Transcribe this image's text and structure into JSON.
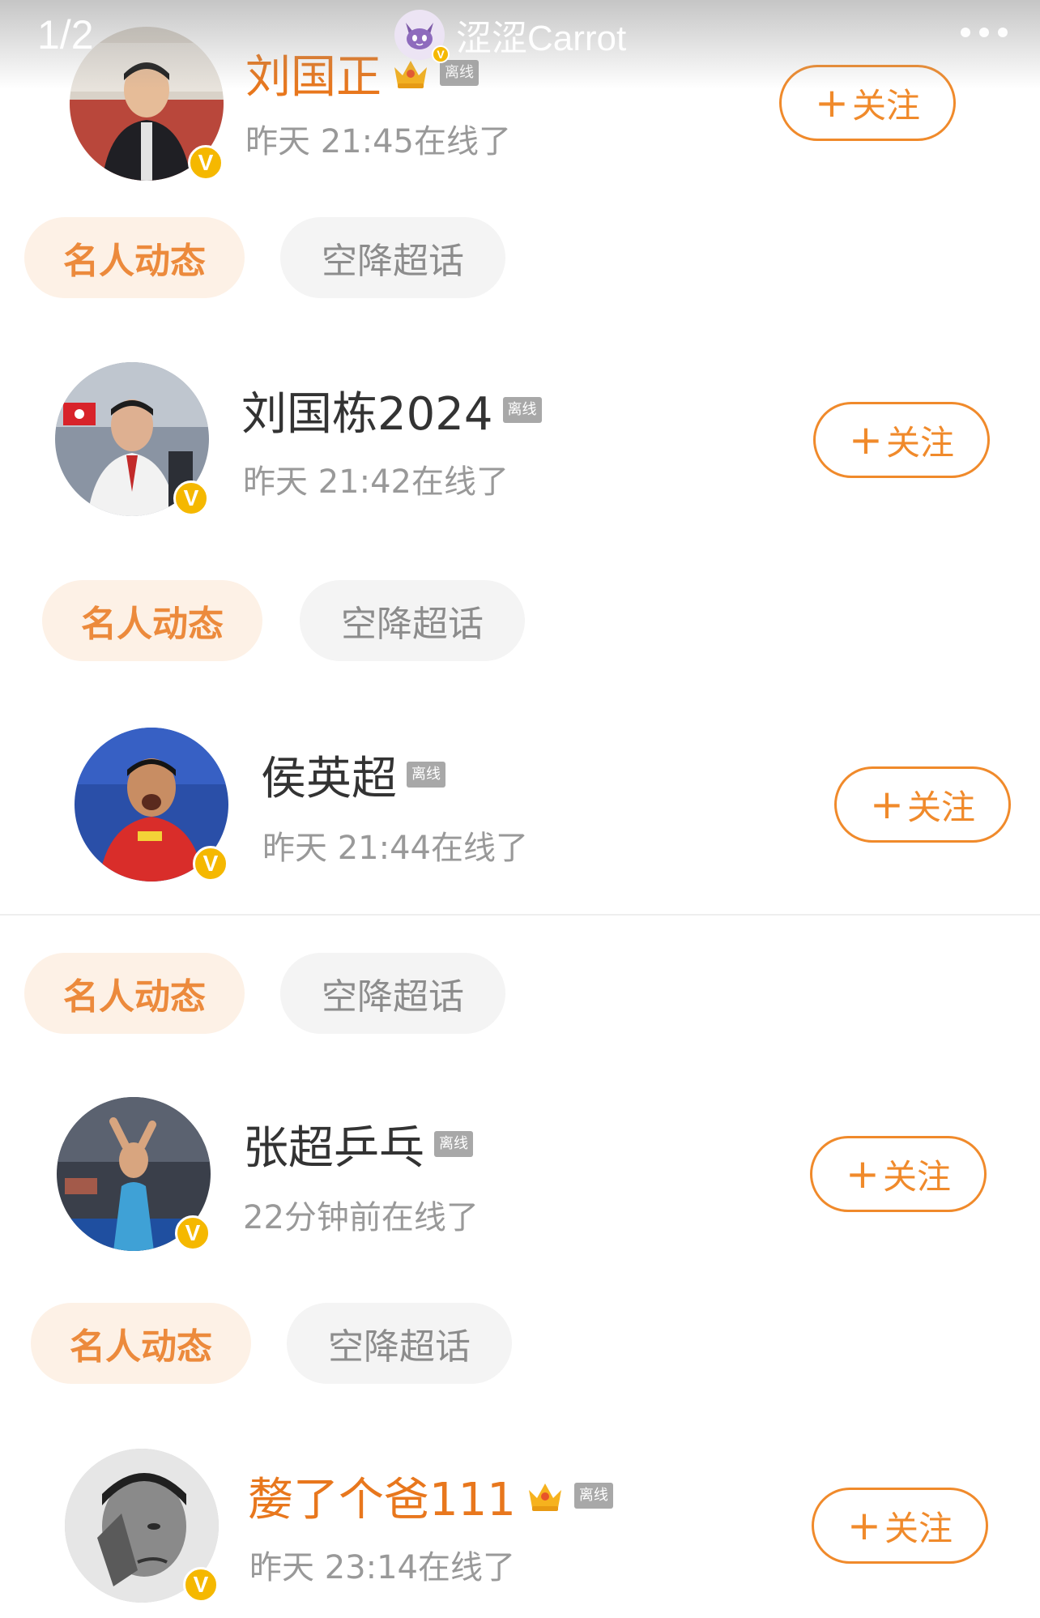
{
  "header": {
    "counter": "1/2",
    "poster_name": "涩涩Carrot",
    "more_label": "•••"
  },
  "accent_color": "#f08a2b",
  "users": [
    {
      "name": "刘国正",
      "vip": true,
      "has_crown": true,
      "badge": "离线",
      "online": "昨天 21:45在线了",
      "follow": "关注"
    },
    {
      "name": "刘国栋2024",
      "vip": false,
      "has_crown": false,
      "badge": "离线",
      "online": "昨天 21:42在线了",
      "follow": "关注"
    },
    {
      "name": "侯英超",
      "vip": false,
      "has_crown": false,
      "badge": "离线",
      "online": "昨天 21:44在线了",
      "follow": "关注"
    },
    {
      "name": "张超乒乓",
      "vip": false,
      "has_crown": false,
      "badge": "离线",
      "online": "22分钟前在线了",
      "follow": "关注"
    },
    {
      "name": "嫠了个爸111",
      "vip": true,
      "has_crown": true,
      "badge": "离线",
      "online": "昨天 23:14在线了",
      "follow": "关注"
    }
  ],
  "tags": [
    {
      "primary": "名人动态",
      "secondary": "空降超话"
    },
    {
      "primary": "名人动态",
      "secondary": "空降超话"
    },
    {
      "primary": "名人动态",
      "secondary": "空降超话"
    },
    {
      "primary": "名人动态",
      "secondary": "空降超话"
    }
  ],
  "verified_badge": "V"
}
